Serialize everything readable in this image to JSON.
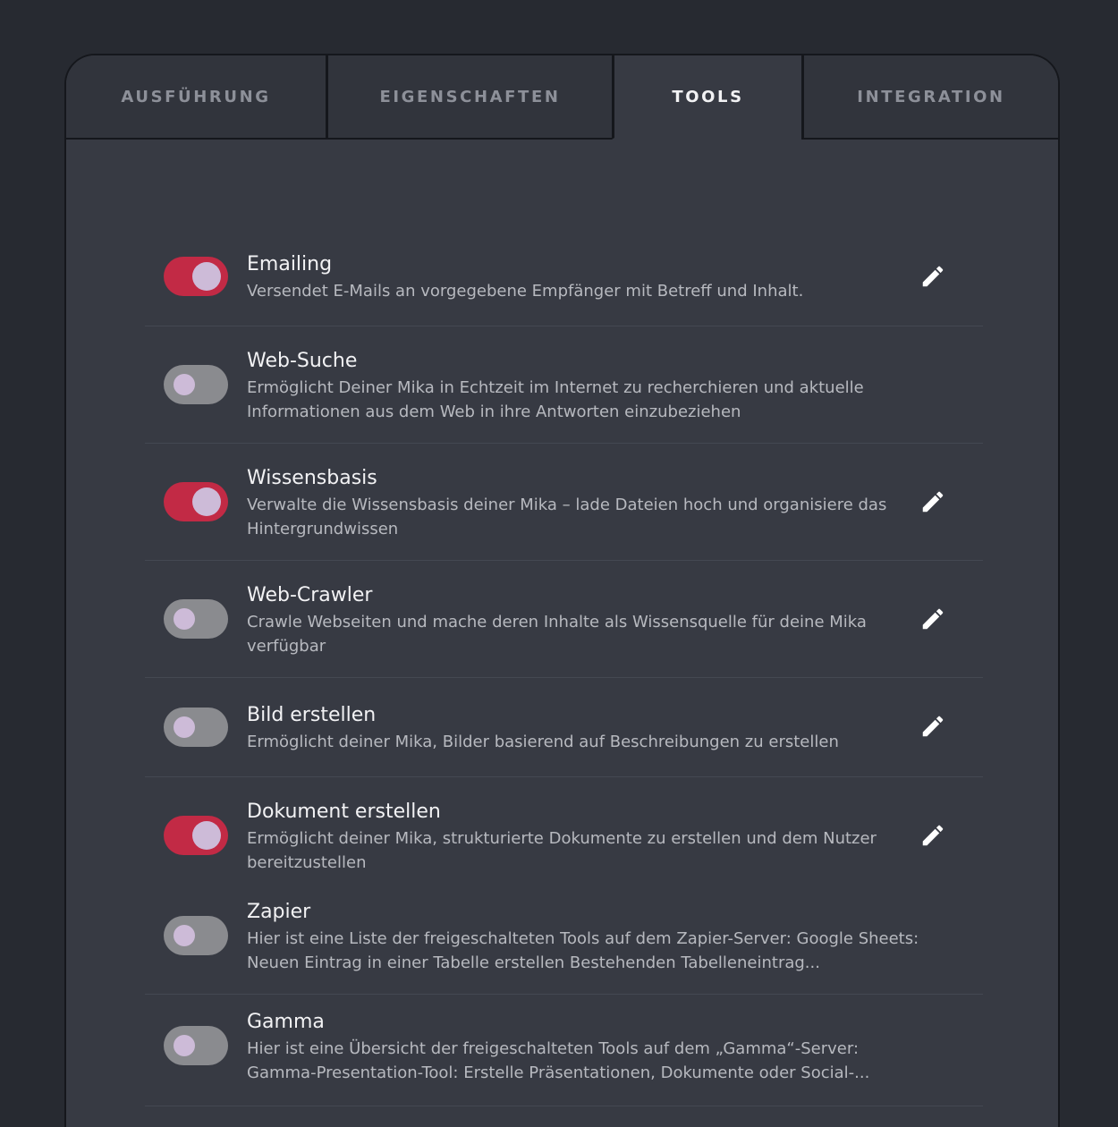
{
  "tabs": [
    {
      "label": "AUSFÜHRUNG",
      "active": false
    },
    {
      "label": "EIGENSCHAFTEN",
      "active": false
    },
    {
      "label": "TOOLS",
      "active": true
    },
    {
      "label": "INTEGRATION",
      "active": false
    }
  ],
  "tools": [
    {
      "title": "Emailing",
      "description": "Versendet E-Mails an vorgegebene Empfänger mit Betreff und Inhalt.",
      "enabled": true,
      "editable": true
    },
    {
      "title": "Web-Suche",
      "description": "Ermöglicht Deiner Mika in Echtzeit im Internet zu recherchieren und aktuelle Informationen aus dem Web in ihre Antworten einzubeziehen",
      "enabled": false,
      "editable": false
    },
    {
      "title": "Wissensbasis",
      "description": "Verwalte die Wissensbasis deiner Mika – lade Dateien hoch und organisiere das Hintergrundwissen",
      "enabled": true,
      "editable": true
    },
    {
      "title": "Web-Crawler",
      "description": "Crawle Webseiten und mache deren Inhalte als Wissensquelle für deine Mika verfügbar",
      "enabled": false,
      "editable": true
    },
    {
      "title": "Bild erstellen",
      "description": "Ermöglicht deiner Mika, Bilder basierend auf Beschreibungen zu erstellen",
      "enabled": false,
      "editable": true
    },
    {
      "title": "Dokument erstellen",
      "description": "Ermöglicht deiner Mika, strukturierte Dokumente zu erstellen und dem Nutzer bereitzustellen",
      "enabled": true,
      "editable": true
    },
    {
      "title": "Zapier",
      "description": "Hier ist eine Liste der freigeschalteten Tools auf dem Zapier-Server: Google Sheets: Neuen Eintrag in einer Tabelle erstellen Bestehenden Tabelleneintrag...",
      "enabled": false,
      "editable": false
    },
    {
      "title": "Gamma",
      "description": "Hier ist eine Übersicht der freigeschalteten Tools auf dem „Gamma“-Server: Gamma-Presentation-Tool: Erstelle Präsentationen, Dokumente oder Social-...",
      "enabled": false,
      "editable": false
    }
  ],
  "colors": {
    "toggle_on": "#c22a45",
    "toggle_off": "#8a8b8f",
    "knob": "#cdbbd8",
    "background": "#272a31",
    "panel": "#373a43"
  },
  "icons": {
    "edit": "pencil-icon"
  }
}
